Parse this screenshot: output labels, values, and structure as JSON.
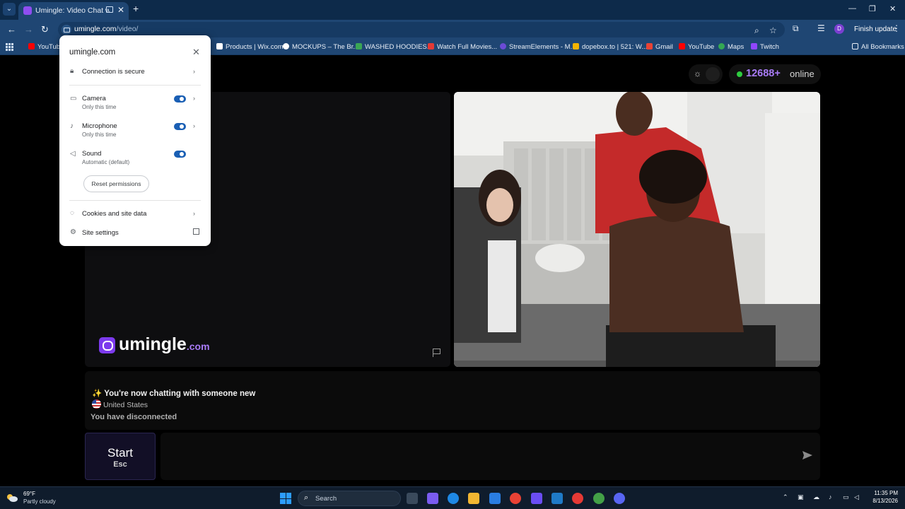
{
  "browser": {
    "tab_title": "Umingle: Video Chat with S",
    "url_host": "umingle.com",
    "url_path": "/video/",
    "finish_update": "Finish update",
    "bookmarks": [
      {
        "label": "YouTube",
        "color": "#ff0000"
      },
      {
        "label": "Products | Wix.com",
        "color": "#ffffff"
      },
      {
        "label": "MOCKUPS – The Br...",
        "color": "#ffffff"
      },
      {
        "label": "WASHED HOODIES...",
        "color": "#3aa655"
      },
      {
        "label": "Watch Full Movies...",
        "color": "#e53935"
      },
      {
        "label": "StreamElements - M...",
        "color": "#6b4bd6"
      },
      {
        "label": "dopebox.to | 521: W...",
        "color": "#f4b400"
      },
      {
        "label": "Gmail",
        "color": "#ea4335"
      },
      {
        "label": "YouTube",
        "color": "#ff0000"
      },
      {
        "label": "Maps",
        "color": "#34a853"
      },
      {
        "label": "Twitch",
        "color": "#9146ff"
      }
    ],
    "all_bookmarks": "All Bookmarks"
  },
  "site_popup": {
    "domain": "umingle.com",
    "connection": "Connection is secure",
    "permissions": [
      {
        "label": "Camera",
        "sub": "Only this time",
        "enabled": true
      },
      {
        "label": "Microphone",
        "sub": "Only this time",
        "enabled": true
      },
      {
        "label": "Sound",
        "sub": "Automatic (default)",
        "enabled": true
      }
    ],
    "reset": "Reset permissions",
    "cookies": "Cookies and site data",
    "site_settings": "Site settings"
  },
  "page": {
    "online_count": "12688+",
    "online_label": "online",
    "logo_name": "umingle",
    "logo_tld": ".com",
    "chat": {
      "new_message": "✨ You're now chatting with someone new",
      "country": "United States",
      "disconnected": "You have disconnected"
    },
    "start_label": "Start",
    "start_key": "Esc"
  },
  "taskbar": {
    "weather_temp": "69°F",
    "weather_desc": "Partly cloudy",
    "search": "Search",
    "time": "11:35 PM",
    "date": "8/13/2026"
  }
}
